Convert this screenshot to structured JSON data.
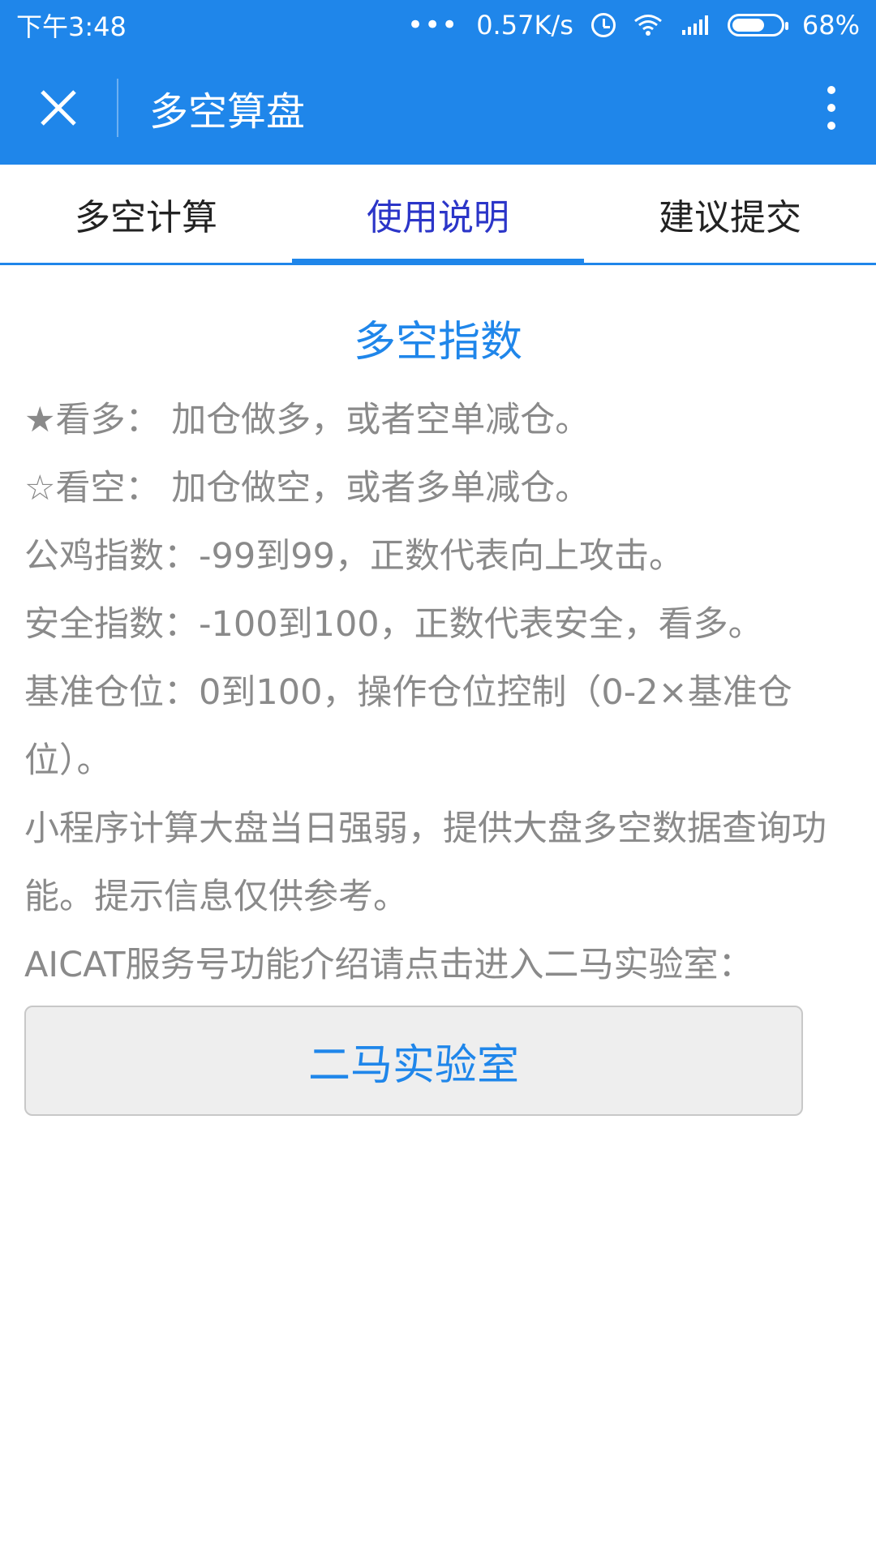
{
  "status_bar": {
    "time": "下午3:48",
    "dots": "•••",
    "net_speed": "0.57K/s",
    "battery": "68%",
    "battery_level": 0.68,
    "icons": [
      "alarm-icon",
      "wifi-icon",
      "signal-icon",
      "battery-icon"
    ]
  },
  "app_bar": {
    "title": "多空算盘",
    "close_icon": "close-icon",
    "more_icon": "more-vertical-icon"
  },
  "tabs": [
    {
      "label": "多空计算",
      "active": false
    },
    {
      "label": "使用说明",
      "active": true
    },
    {
      "label": "建议提交",
      "active": false
    }
  ],
  "content": {
    "title": "多空指数",
    "lines": [
      "★看多： 加仓做多，或者空单减仓。",
      "☆看空： 加仓做空，或者多单减仓。",
      "公鸡指数：-99到99，正数代表向上攻击。",
      "安全指数：-100到100，正数代表安全，看多。",
      "基准仓位：0到100，操作仓位控制（0-2×基准仓位）。",
      "小程序计算大盘当日强弱，提供大盘多空数据查询功能。提示信息仅供参考。",
      "AICAT服务号功能介绍请点击进入二马实验室："
    ],
    "button_label": "二马实验室"
  },
  "colors": {
    "primary": "#1f86ea",
    "active_tab_text": "#2b35c8",
    "body_text": "#8a8a8a"
  }
}
